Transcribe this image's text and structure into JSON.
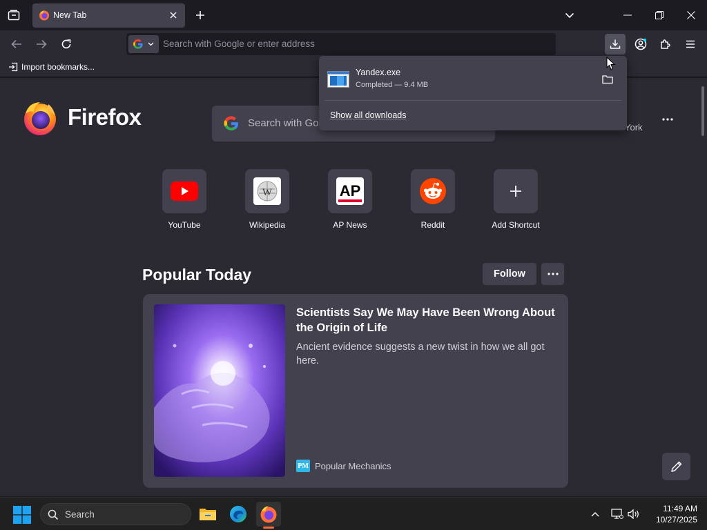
{
  "browser": {
    "tab": {
      "title": "New Tab"
    },
    "urlbar": {
      "placeholder": "Search with Google or enter address"
    },
    "bookmarks": {
      "import_label": "Import bookmarks..."
    }
  },
  "newtab": {
    "brand": "Firefox",
    "search_placeholder": "Search with Google or enter address",
    "weather_fragment": "York",
    "shortcuts": [
      {
        "label": "YouTube",
        "icon": "youtube-icon"
      },
      {
        "label": "Wikipedia",
        "icon": "wikipedia-icon"
      },
      {
        "label": "AP News",
        "icon": "ap-news-icon"
      },
      {
        "label": "Reddit",
        "icon": "reddit-icon"
      },
      {
        "label": "Add Shortcut",
        "icon": "plus-icon"
      }
    ],
    "popular": {
      "title": "Popular Today",
      "follow_label": "Follow",
      "story": {
        "headline": "Scientists Say We May Have Been Wrong About the Origin of Life",
        "excerpt": "Ancient evidence suggests a new twist in how we all got here.",
        "source_badge": "PM",
        "source": "Popular Mechanics"
      }
    }
  },
  "downloads": {
    "item": {
      "name": "Yandex.exe",
      "status": "Completed — 9.4 MB"
    },
    "show_all_label": "Show all downloads"
  },
  "taskbar": {
    "search_label": "Search",
    "clock": {
      "time": "11:49 AM",
      "date": "10/27/2025"
    }
  },
  "colors": {
    "accent": "#ff6a3d",
    "panel_bg": "#42414d",
    "content_bg": "#2b2a33"
  }
}
